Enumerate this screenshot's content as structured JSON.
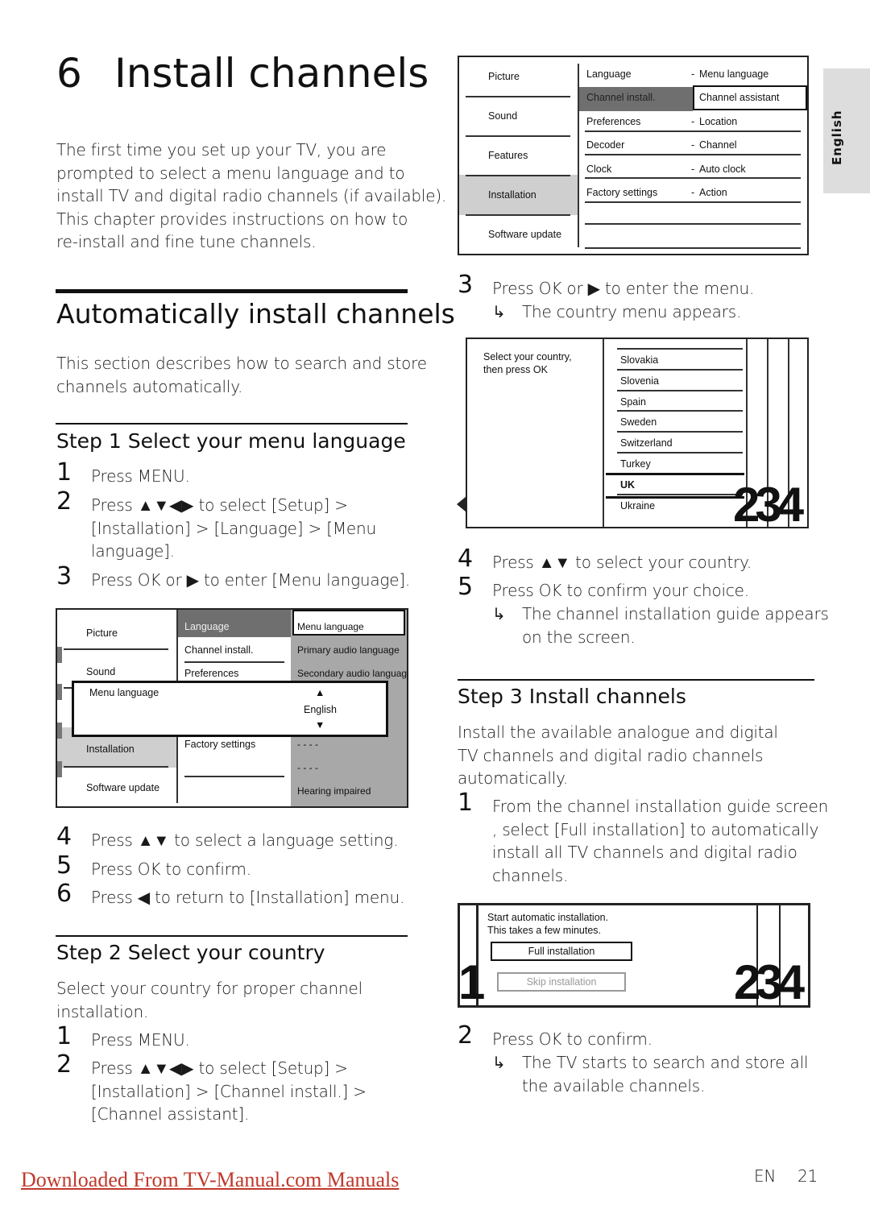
{
  "side_tab": "English",
  "chapter": {
    "number": "6",
    "title": "Install channels"
  },
  "intro": [
    "The first time you set up your TV, you are",
    "prompted to select a menu language and to",
    "install TV and digital radio channels (if available).",
    "This chapter provides instructions on how to",
    "re-install and fine tune channels."
  ],
  "section": {
    "title": "Automatically install channels",
    "desc": [
      "This section describes how to search and store",
      "channels automatically."
    ]
  },
  "step1": {
    "title": "Step 1 Select your menu language",
    "items": [
      {
        "n": "1",
        "lines": [
          "Press MENU."
        ]
      },
      {
        "n": "2",
        "lines": [
          "Press ▲▼◀▶ to select [Setup] >",
          "[Installation] > [Language] > [Menu",
          "language]."
        ]
      },
      {
        "n": "3",
        "lines": [
          "Press OK or ▶ to enter [Menu language]."
        ]
      }
    ],
    "items2": [
      {
        "n": "4",
        "lines": [
          "Press ▲▼ to select a language setting."
        ]
      },
      {
        "n": "5",
        "lines": [
          "Press OK to confirm."
        ]
      },
      {
        "n": "6",
        "lines": [
          "Press ◀ to return to [Installation] menu."
        ]
      }
    ]
  },
  "menu1": {
    "left": [
      "Picture",
      "Sound",
      "",
      "Installation",
      "Software update"
    ],
    "mid": [
      "Language",
      "Channel install.",
      "Preferences",
      "Factory settings"
    ],
    "right": [
      "Menu language",
      "Primary audio language",
      "Secondary audio language",
      "- - - -",
      "- - - -",
      "Hearing impaired"
    ],
    "popup": {
      "label": "Menu language",
      "value": "English"
    }
  },
  "step2": {
    "title": "Step 2 Select your country",
    "desc": [
      "Select your country for proper channel",
      "installation."
    ],
    "items": [
      {
        "n": "1",
        "lines": [
          "Press MENU."
        ]
      },
      {
        "n": "2",
        "lines": [
          "Press ▲▼◀▶ to select [Setup] >",
          "[Installation] > [Channel install.] >",
          "[Channel assistant]."
        ]
      }
    ]
  },
  "menu2": {
    "left": [
      "Picture",
      "Sound",
      "Features",
      "Installation",
      "Software update"
    ],
    "mid": [
      "Language",
      "Channel install.",
      "Preferences",
      "Decoder",
      "Clock",
      "Factory settings"
    ],
    "right": [
      "Menu language",
      "Channel assistant",
      "Location",
      "Channel",
      "Auto clock",
      "Action"
    ]
  },
  "step3a": {
    "n": "3",
    "line": "Press OK or ▶ to enter the menu.",
    "result": "The country menu appears."
  },
  "country": {
    "prompt": [
      "Select your country,",
      "then press OK"
    ],
    "list": [
      "Slovakia",
      "Slovenia",
      "Spain",
      "Sweden",
      "Switzerland",
      "Turkey",
      "UK",
      "Ukraine"
    ],
    "selected": "UK",
    "steps": "234"
  },
  "step2b": {
    "items": [
      {
        "n": "4",
        "lines": [
          "Press ▲▼ to select your country."
        ]
      },
      {
        "n": "5",
        "lines": [
          "Press OK to confirm your choice."
        ]
      }
    ],
    "result": [
      "The channel installation guide appears",
      "on the screen."
    ]
  },
  "step3": {
    "title": "Step 3 Install channels",
    "desc": [
      "Install the available analogue and digital",
      "TV channels and digital radio channels",
      "automatically."
    ],
    "item1": {
      "n": "1",
      "lines": [
        "From the channel installation guide screen",
        ", select [Full installation] to automatically",
        "install all TV channels and digital radio",
        "channels."
      ]
    },
    "item2": {
      "n": "2",
      "line": "Press OK to confirm.",
      "result": [
        "The TV starts to search and store all",
        "the available channels."
      ]
    }
  },
  "install_screen": {
    "text": [
      "Start automatic installation.",
      "This takes a few minutes."
    ],
    "full": "Full installation",
    "skip": "Skip installation",
    "left_num": "1",
    "right_num": "234"
  },
  "footer": {
    "link": "Downloaded From TV-Manual.com Manuals",
    "lang": "EN",
    "page": "21"
  },
  "colors": {
    "dark_highlight": "#6f6f6f",
    "light_highlight": "#cfcfcf",
    "link": "#c0392b"
  }
}
